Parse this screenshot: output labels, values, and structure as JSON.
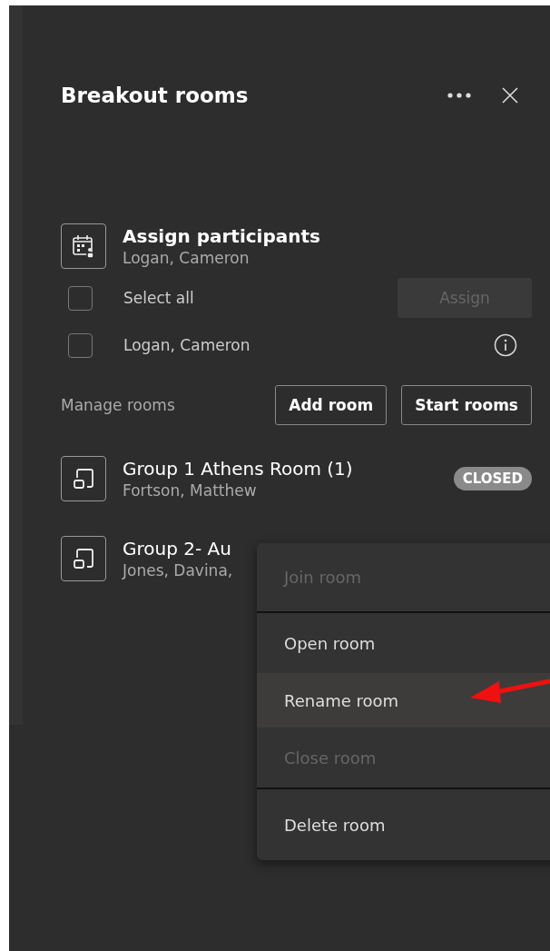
{
  "panel": {
    "title": "Breakout rooms"
  },
  "assign": {
    "title": "Assign participants",
    "subtitle": "Logan, Cameron",
    "select_all": {
      "label": "Select all",
      "checked": false
    },
    "assign_button": {
      "label": "Assign",
      "disabled": true
    },
    "participants": [
      {
        "name": "Logan, Cameron",
        "checked": false
      }
    ]
  },
  "manage": {
    "label": "Manage rooms",
    "buttons": [
      "Add room",
      "Start rooms"
    ]
  },
  "rooms": [
    {
      "name": "Group 1 Athens Room (1)",
      "members": "Fortson, Matthew",
      "badge": "CLOSED"
    },
    {
      "name": "Group 2- Au",
      "members": "Jones, Davina,"
    }
  ],
  "context_menu": {
    "items": [
      {
        "label": "Join room",
        "disabled": true,
        "selected": false,
        "separator_after": true
      },
      {
        "label": "Open room",
        "disabled": false,
        "selected": false,
        "separator_after": false
      },
      {
        "label": "Rename room",
        "disabled": false,
        "selected": true,
        "separator_after": false
      },
      {
        "label": "Close room",
        "disabled": true,
        "selected": false,
        "separator_after": true
      },
      {
        "label": "Delete room",
        "disabled": false,
        "selected": false,
        "separator_after": false
      }
    ]
  }
}
